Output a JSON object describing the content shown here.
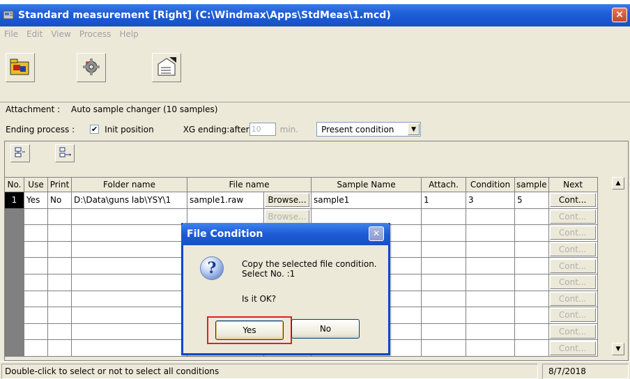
{
  "window": {
    "title": "Standard measurement [Right] (C:\\Windmax\\Apps\\StdMeas\\1.mcd)",
    "close_label": "×"
  },
  "menu": [
    "File",
    "Edit",
    "View",
    "Process",
    "Help"
  ],
  "settings": {
    "attachment_label": "Attachment :",
    "attachment_value": "Auto sample changer (10 samples)",
    "ending_label": "Ending process :",
    "init_checked_mark": "✔",
    "init_label": "Init position",
    "xg_label": "XG ending:after",
    "xg_value": "10",
    "xg_unit": "min.",
    "condition_select": "Present condition"
  },
  "table": {
    "headers": [
      "No.",
      "Use",
      "Print",
      "Folder name",
      "File name",
      "Sample Name",
      "Attach.",
      "Condition",
      "sample",
      "Next"
    ],
    "row1": {
      "no": "1",
      "use": "Yes",
      "print": "No",
      "folder": "D:\\Data\\guns lab\\YSY\\1",
      "file": "sample1.raw",
      "browse": "Browse...",
      "sample_name": "sample1",
      "attach": "1",
      "condition": "3",
      "sample": "5",
      "next": "Cont..."
    },
    "browse_disabled": "Browse...",
    "cont_disabled": "Cont..."
  },
  "dialog": {
    "title": "File Condition",
    "message_line1": "Copy the selected file condition.",
    "message_line2": "Select No. :1",
    "question": "Is it OK?",
    "yes_label": "Yes",
    "no_label": "No"
  },
  "status": {
    "hint": "Double-click to select or not to select all conditions",
    "date": "8/7/2018"
  },
  "colors": {
    "titlebar": "#1f5fd8",
    "window_bg": "#ece9d8",
    "highlight_box": "#e02020"
  }
}
